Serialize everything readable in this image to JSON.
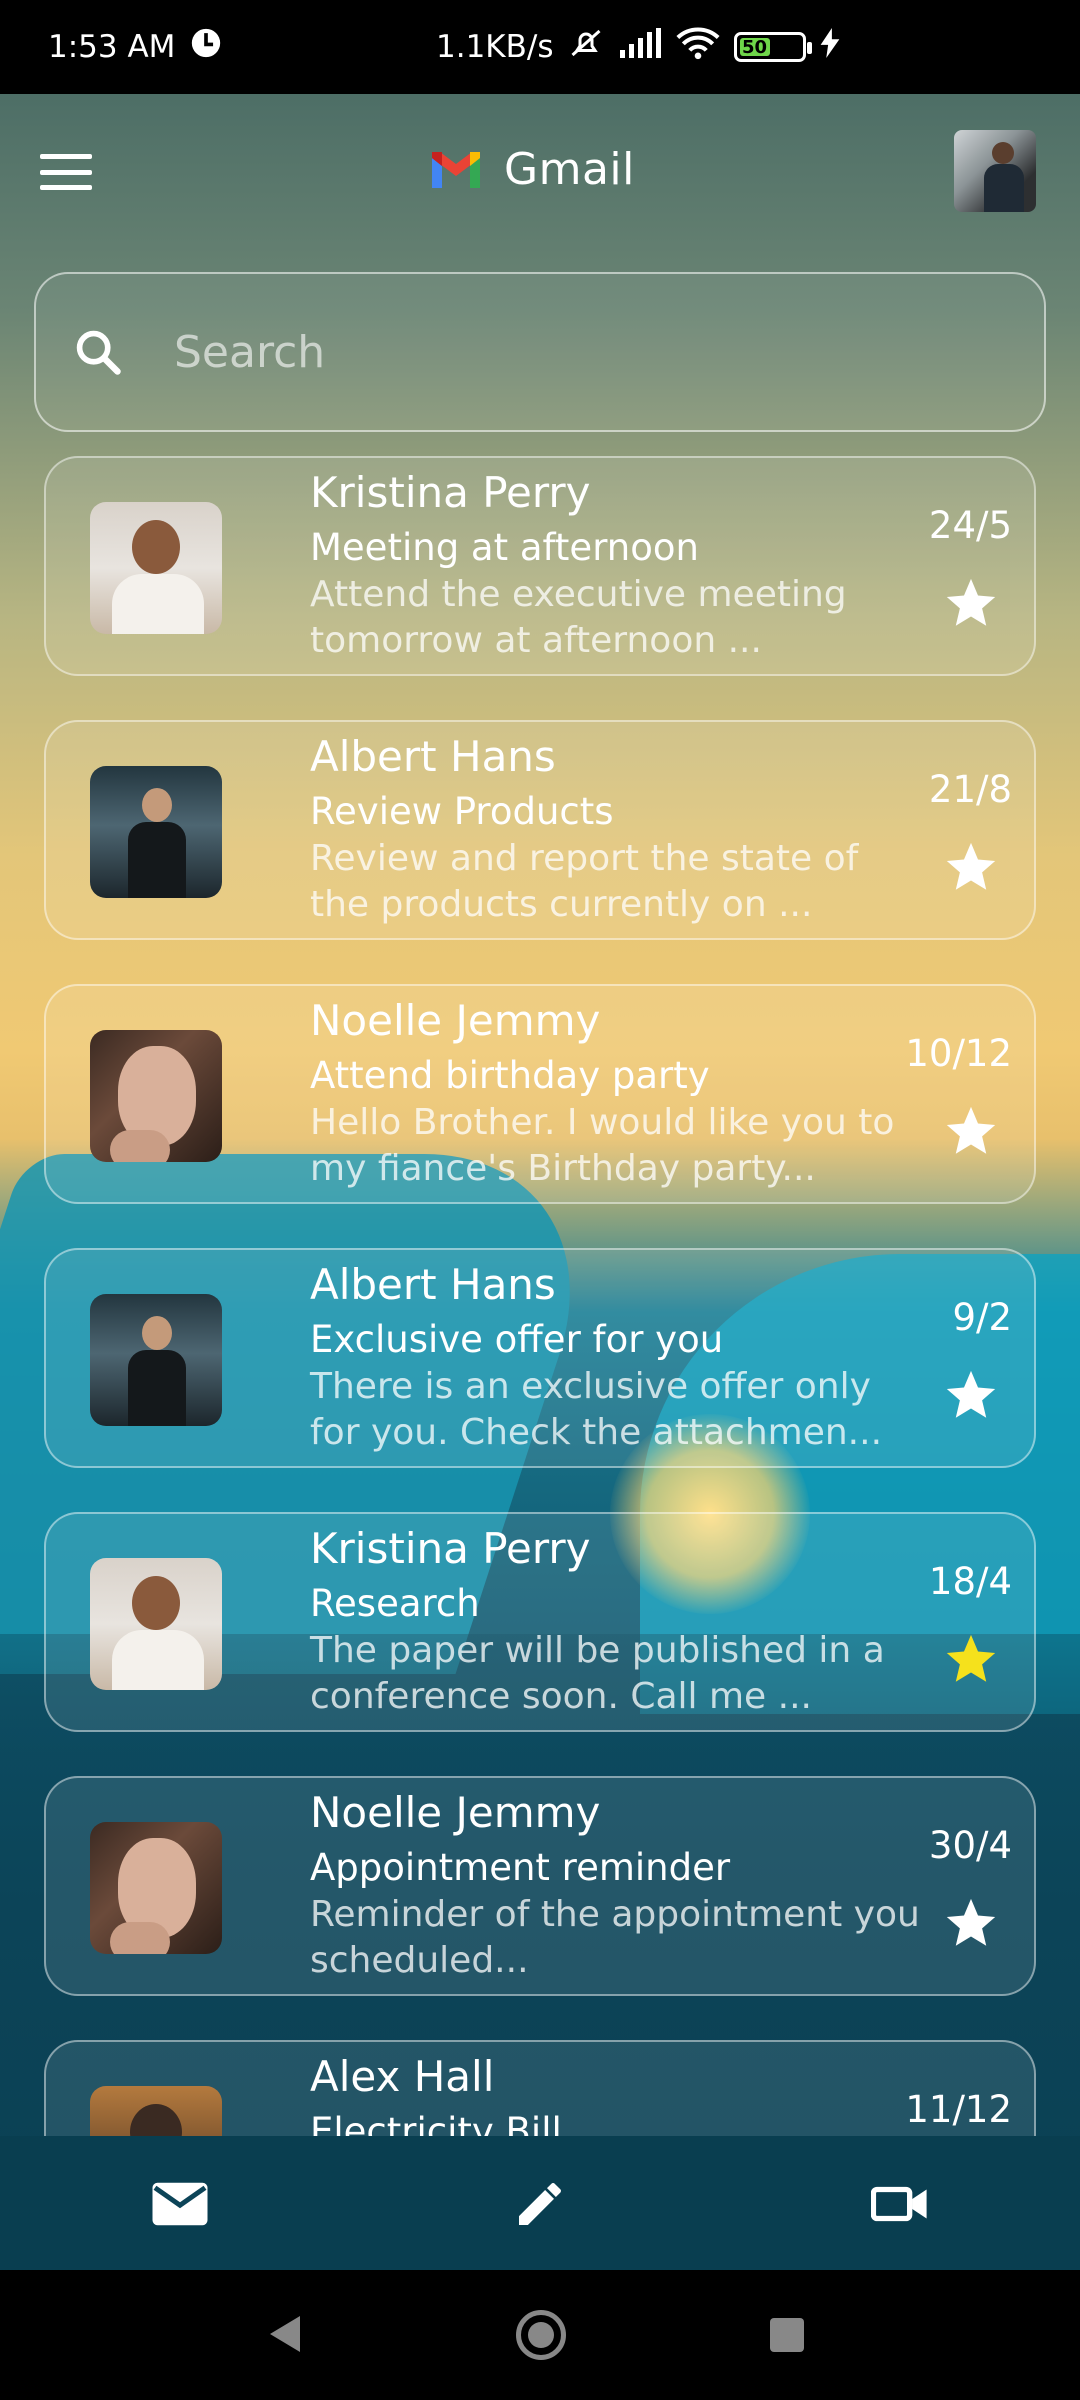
{
  "status_bar": {
    "time": "1:53 AM",
    "network_speed": "1.1KB/s",
    "battery_level": "50"
  },
  "header": {
    "title": "Gmail",
    "menu_icon": "hamburger-menu-icon",
    "logo_icon": "gmail-logo-icon",
    "avatar_icon": "profile-avatar"
  },
  "search": {
    "placeholder": "Search",
    "value": ""
  },
  "emails": [
    {
      "sender": "Kristina Perry",
      "subject": "Meeting at afternoon",
      "preview": "Attend the executive meeting tomorrow at afternoon ...",
      "date": "24/5",
      "starred": false,
      "avatar": "kristina"
    },
    {
      "sender": "Albert Hans",
      "subject": "Review Products",
      "preview": "Review and report the state of the products currently on ...",
      "date": "21/8",
      "starred": false,
      "avatar": "albert"
    },
    {
      "sender": "Noelle Jemmy",
      "subject": "Attend birthday party",
      "preview": "Hello Brother. I would like you to my fiance's Birthday party...",
      "date": "10/12",
      "starred": false,
      "avatar": "noelle"
    },
    {
      "sender": "Albert Hans",
      "subject": "Exclusive offer for you",
      "preview": "There is an exclusive offer only for you. Check the attachmen...",
      "date": "9/2",
      "starred": false,
      "avatar": "albert"
    },
    {
      "sender": "Kristina Perry",
      "subject": "Research",
      "preview": "The paper will be published in a conference soon. Call me ...",
      "date": "18/4",
      "starred": true,
      "avatar": "kristina"
    },
    {
      "sender": "Noelle Jemmy",
      "subject": "Appointment reminder",
      "preview": "Reminder of the appointment you scheduled...",
      "date": "30/4",
      "starred": false,
      "avatar": "noelle"
    },
    {
      "sender": "Alex Hall",
      "subject": "Electricity Bill",
      "preview": "",
      "date": "11/12",
      "starred": false,
      "avatar": "alex"
    }
  ],
  "bottom_nav": {
    "items": [
      {
        "icon": "mail-icon"
      },
      {
        "icon": "pencil-compose-icon"
      },
      {
        "icon": "video-camera-icon"
      }
    ]
  },
  "colors": {
    "star_default": "#ffffff",
    "star_active": "#f5e11c",
    "battery": "#6fd64a"
  }
}
